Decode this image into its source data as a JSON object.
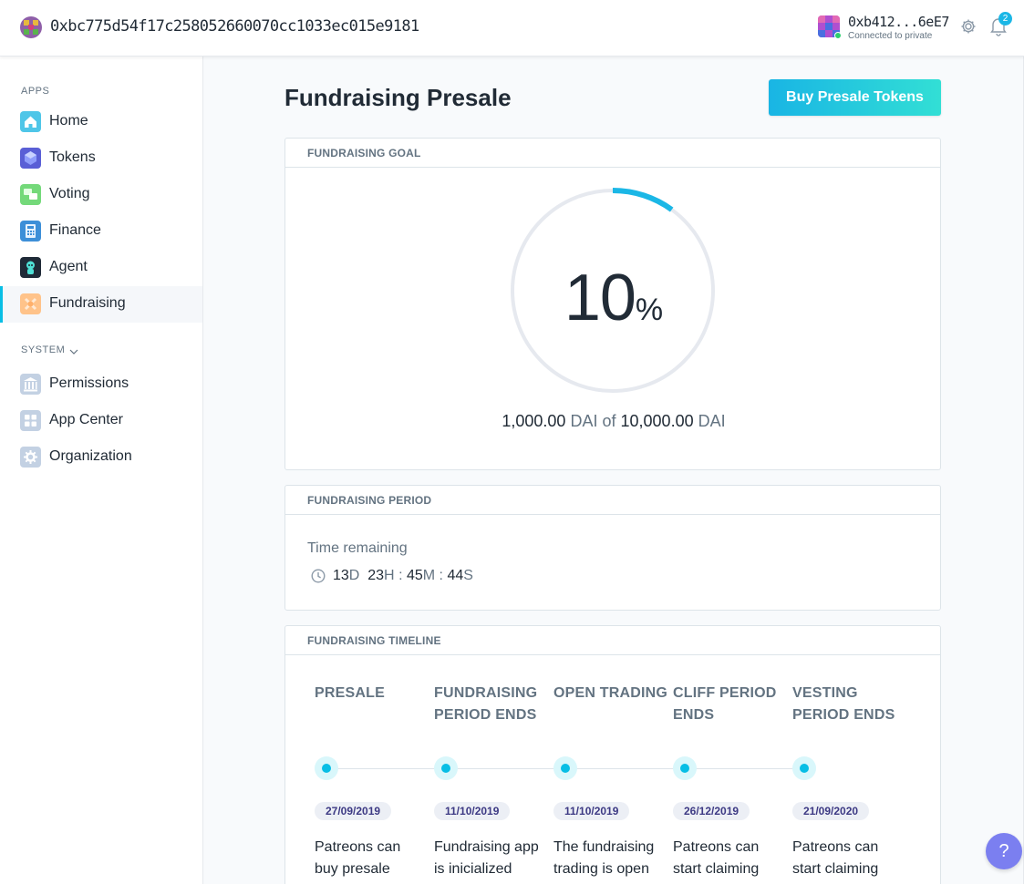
{
  "topbar": {
    "org_address": "0xbc775d54f17c258052660070cc1033ec015e9181",
    "account_address": "0xb412...6eE7",
    "account_status": "Connected to private",
    "notification_count": "2",
    "icons": [
      "org-identicon",
      "account-identicon",
      "gear-icon",
      "bell-icon"
    ]
  },
  "sidebar": {
    "apps_label": "APPS",
    "system_label": "SYSTEM",
    "apps": [
      {
        "label": "Home",
        "icon": "home-icon"
      },
      {
        "label": "Tokens",
        "icon": "tokens-icon"
      },
      {
        "label": "Voting",
        "icon": "voting-icon"
      },
      {
        "label": "Finance",
        "icon": "finance-icon"
      },
      {
        "label": "Agent",
        "icon": "agent-icon"
      },
      {
        "label": "Fundraising",
        "icon": "fundraising-icon",
        "active": true
      }
    ],
    "system": [
      {
        "label": "Permissions",
        "icon": "permissions-icon"
      },
      {
        "label": "App Center",
        "icon": "app-center-icon"
      },
      {
        "label": "Organization",
        "icon": "organization-icon"
      }
    ]
  },
  "main": {
    "title": "Fundraising Presale",
    "buy_button": "Buy Presale Tokens",
    "goal": {
      "header": "FUNDRAISING GOAL",
      "percent": "10",
      "percent_symbol": "%",
      "progress_fraction": 0.1,
      "raised_amount": "1,000.00",
      "raised_unit": "DAI",
      "of_text": "of",
      "goal_amount": "10,000.00",
      "goal_unit": "DAI"
    },
    "period": {
      "header": "FUNDRAISING PERIOD",
      "time_remaining_label": "Time remaining",
      "days": "13",
      "days_unit": "D",
      "hours": "23",
      "hours_unit": "H",
      "minutes": "45",
      "minutes_unit": "M",
      "seconds": "44",
      "seconds_unit": "S",
      "separator": ":"
    },
    "timeline": {
      "header": "FUNDRAISING TIMELINE",
      "steps": [
        {
          "title_1": "PRESALE",
          "title_2": "",
          "date": "27/09/2019",
          "desc_1": "Patreons can",
          "desc_2": "buy presale"
        },
        {
          "title_1": "FUNDRAISING",
          "title_2": "PERIOD ENDS",
          "date": "11/10/2019",
          "desc_1": "Fundraising app",
          "desc_2": "is inicialized"
        },
        {
          "title_1": "OPEN TRADING",
          "title_2": "",
          "date": "11/10/2019",
          "desc_1": "The fundraising",
          "desc_2": "trading is open"
        },
        {
          "title_1": "CLIFF PERIOD",
          "title_2": "ENDS",
          "date": "26/12/2019",
          "desc_1": "Patreons can",
          "desc_2": "start claiming"
        },
        {
          "title_1": "VESTING",
          "title_2": "PERIOD ENDS",
          "date": "21/09/2020",
          "desc_1": "Patreons can",
          "desc_2": "start claiming"
        }
      ]
    }
  },
  "help_button": "?",
  "colors": {
    "accent": "#08bee5",
    "button_gradient_start": "#19b5e4",
    "button_gradient_end": "#32dfd5",
    "help_button": "#7b7ff0",
    "date_badge_text": "#3d3a84"
  }
}
